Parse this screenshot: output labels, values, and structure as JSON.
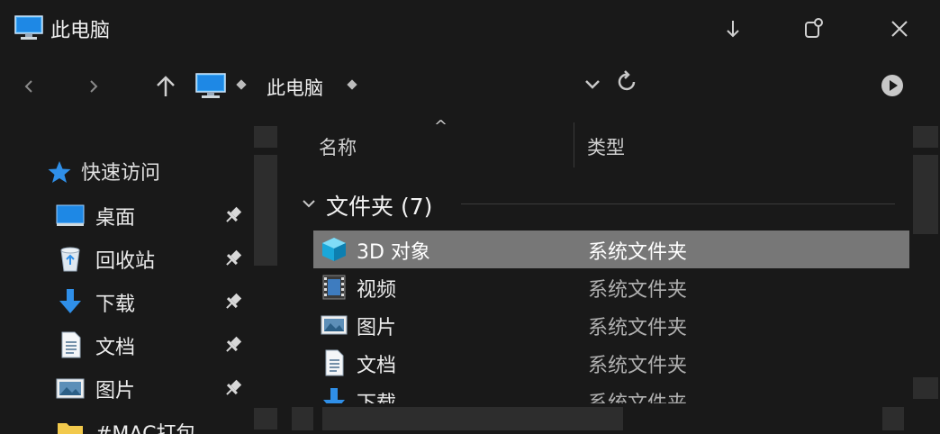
{
  "window": {
    "title": "此电脑",
    "title_icon": "computer-icon",
    "controls": [
      "download-icon",
      "pin-icon",
      "close-icon"
    ]
  },
  "address_bar": {
    "back_icon": "back-icon",
    "forward_icon": "forward-icon",
    "up_icon": "up-icon",
    "location_icon": "computer-icon",
    "path_text": "此电脑",
    "dropdown_icon": "chevron-down-icon",
    "refresh_icon": "refresh-icon",
    "go_icon": "play-icon"
  },
  "sidebar": {
    "quick_access_label": "快速访问",
    "items": [
      {
        "label": "桌面",
        "icon": "desktop-icon",
        "pinned": true
      },
      {
        "label": "回收站",
        "icon": "recycle-bin-icon",
        "pinned": true
      },
      {
        "label": "下载",
        "icon": "download-arrow-icon",
        "pinned": true
      },
      {
        "label": "文档",
        "icon": "document-icon",
        "pinned": true
      },
      {
        "label": "图片",
        "icon": "pictures-icon",
        "pinned": true
      },
      {
        "label": "#MAC打包",
        "icon": "folder-icon",
        "pinned": false
      }
    ]
  },
  "columns": {
    "name": "名称",
    "type": "类型",
    "sort_indicator": "^"
  },
  "group": {
    "label": "文件夹 (7)"
  },
  "files": [
    {
      "name": "3D 对象",
      "type": "系统文件夹",
      "icon": "3d-objects-icon",
      "selected": true
    },
    {
      "name": "视频",
      "type": "系统文件夹",
      "icon": "videos-icon",
      "selected": false
    },
    {
      "name": "图片",
      "type": "系统文件夹",
      "icon": "pictures-icon",
      "selected": false
    },
    {
      "name": "文档",
      "type": "系统文件夹",
      "icon": "document-icon",
      "selected": false
    },
    {
      "name": "下载",
      "type": "系统文件夹",
      "icon": "download-arrow-icon",
      "selected": false
    }
  ],
  "colors": {
    "background": "#191919",
    "selection": "#777777",
    "accent_blue": "#2f8fe8"
  }
}
